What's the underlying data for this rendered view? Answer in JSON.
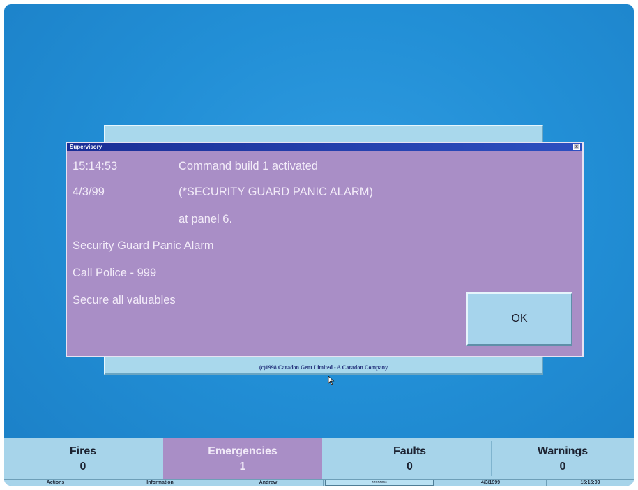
{
  "dialog": {
    "title": "Supervisory",
    "time": "15:14:53",
    "date": "4/3/99",
    "message_line1": "Command build 1 activated",
    "message_line2": "(*SECURITY GUARD PANIC ALARM)",
    "message_line3": "at panel 6.",
    "info_line1": "Security Guard Panic Alarm",
    "info_line2": "Call Police - 999",
    "info_line3": "Secure all valuables",
    "ok_label": "OK",
    "close_label": "x"
  },
  "copyright": "(c)1998 Caradon Gent Limited - A Caradon Company",
  "status_tiles": [
    {
      "label": "Fires",
      "count": "0",
      "active": false
    },
    {
      "label": "Emergencies",
      "count": "1",
      "active": true
    },
    {
      "label": "Faults",
      "count": "0",
      "active": false
    },
    {
      "label": "Warnings",
      "count": "0",
      "active": false
    }
  ],
  "bottom_bar": {
    "actions": "Actions",
    "information": "Information",
    "user": "Andrew",
    "password": "********",
    "date": "4/3/1999",
    "time": "15:15:09"
  },
  "colors": {
    "desktop": "#228fd6",
    "dialog": "#a98ec6",
    "panel": "#a7d4ea",
    "title_bar": "#1a2e96"
  }
}
